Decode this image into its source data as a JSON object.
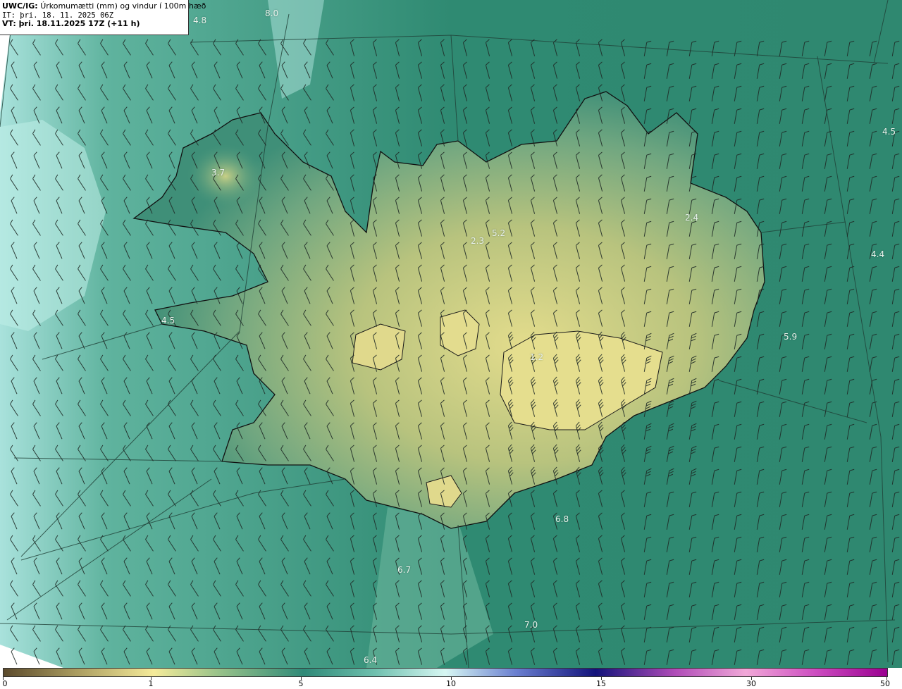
{
  "header": {
    "model": "UWC/IG:",
    "title": "Úrkomumætti (mm) og vindur í 100m hæð",
    "issue_line": "IT: þri. 18. 11. 2025 06Z",
    "valid_line": "VT: þri. 18.11.2025 17Z (+11 h)"
  },
  "value_labels": [
    {
      "text": "4.8"
    },
    {
      "text": "8.0"
    },
    {
      "text": "4.5"
    },
    {
      "text": "3.7"
    },
    {
      "text": "2.4"
    },
    {
      "text": "4.4"
    },
    {
      "text": "5.2"
    },
    {
      "text": "2.3"
    },
    {
      "text": "4.5"
    },
    {
      "text": "5.9"
    },
    {
      "text": "1.2"
    },
    {
      "text": "6.8"
    },
    {
      "text": "6.7"
    },
    {
      "text": "7.0"
    },
    {
      "text": "6.4"
    }
  ],
  "colorbar": {
    "ticks": [
      "0",
      "1",
      "5",
      "10",
      "15",
      "30",
      "50"
    ],
    "colors": {
      "c0": "#5b4a2c",
      "c1": "#f5eb9a",
      "c5": "#2f8a78",
      "c10": "#d7f7f3",
      "c15": "#12127a",
      "c30": "#f1a8d8",
      "c50": "#9a0090"
    }
  },
  "colors": {
    "sea": "#3f9a84",
    "land_low": "#2b7d68",
    "land_high": "#d8d48a",
    "coast": "#111111"
  }
}
